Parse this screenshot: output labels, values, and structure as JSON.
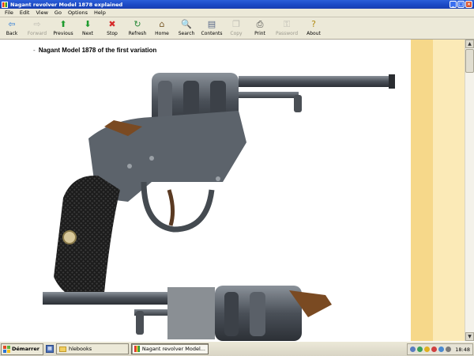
{
  "window": {
    "title": "Nagant revolver Model 1878 explained"
  },
  "menu": [
    "File",
    "Edit",
    "View",
    "Go",
    "Options",
    "Help"
  ],
  "toolbar": [
    {
      "label": "Back",
      "icon": "back-arrow-icon",
      "glyph": "⇦",
      "color": "#2e7bd6",
      "enabled": true,
      "width": 30
    },
    {
      "label": "Forward",
      "icon": "forward-arrow-icon",
      "glyph": "⇨",
      "color": "#888888",
      "enabled": false,
      "width": 34
    },
    {
      "label": "Previous",
      "icon": "up-arrow-icon",
      "glyph": "⬆",
      "color": "#1e9b2e",
      "enabled": true,
      "width": 32
    },
    {
      "label": "Next",
      "icon": "down-arrow-icon",
      "glyph": "⬇",
      "color": "#1e9b2e",
      "enabled": true,
      "width": 30
    },
    {
      "label": "Stop",
      "icon": "stop-icon",
      "glyph": "✖",
      "color": "#d62b2b",
      "enabled": true,
      "width": 32
    },
    {
      "label": "Refresh",
      "icon": "refresh-icon",
      "glyph": "↻",
      "color": "#2a8a3a",
      "enabled": true,
      "width": 32
    },
    {
      "label": "Home",
      "icon": "home-icon",
      "glyph": "⌂",
      "color": "#7a5a2a",
      "enabled": true,
      "width": 30
    },
    {
      "label": "Search",
      "icon": "search-icon",
      "glyph": "🔍",
      "color": "#2e5fa8",
      "enabled": true,
      "width": 32
    },
    {
      "label": "Contents",
      "icon": "contents-icon",
      "glyph": "▤",
      "color": "#5a6a8a",
      "enabled": true,
      "width": 32
    },
    {
      "label": "Copy",
      "icon": "copy-icon",
      "glyph": "❐",
      "color": "#888888",
      "enabled": false,
      "width": 30
    },
    {
      "label": "Print",
      "icon": "print-icon",
      "glyph": "⎙",
      "color": "#444444",
      "enabled": true,
      "width": 30
    },
    {
      "label": "Password",
      "icon": "key-icon",
      "glyph": "⚿",
      "color": "#888888",
      "enabled": false,
      "width": 38
    },
    {
      "label": "About",
      "icon": "about-icon",
      "glyph": "?",
      "color": "#b08a10",
      "enabled": true,
      "width": 30
    }
  ],
  "content": {
    "caption": "Nagant Model 1878 of the first variation",
    "bullet": "-"
  },
  "taskbar": {
    "start_label": "Démarrer",
    "tasks": [
      {
        "label": "hlebooks",
        "icon": "folder-icon",
        "active": false
      },
      {
        "label": "Nagant revolver Model...",
        "icon": "app-icon",
        "active": true
      }
    ],
    "clock": "18:48"
  },
  "colors": {
    "titlebar": "#1a48c4",
    "right_band_dark": "#f6d88a",
    "right_band_light": "#fbeab7"
  }
}
